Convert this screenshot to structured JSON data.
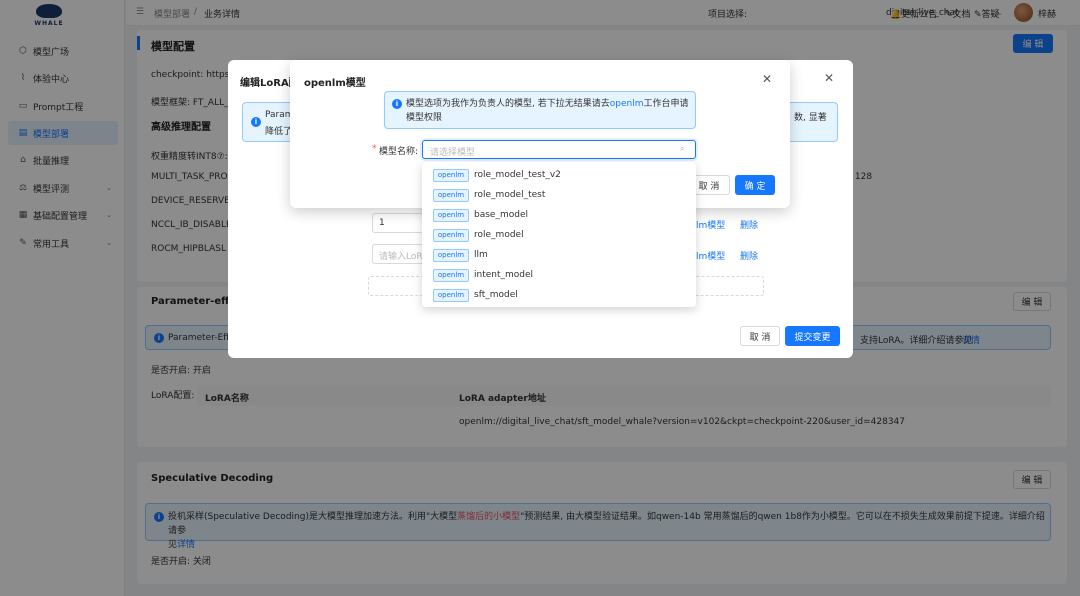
{
  "brand": {
    "logo_text": "WHALE"
  },
  "sidebar": {
    "items": [
      {
        "label": "模型广场",
        "icon": "cube-icon",
        "glyph": "⬡",
        "has_chevron": false
      },
      {
        "label": "体验中心",
        "icon": "chart-icon",
        "glyph": "⌇",
        "has_chevron": false
      },
      {
        "label": "Prompt工程",
        "icon": "chat-icon",
        "glyph": "▭",
        "has_chevron": false
      },
      {
        "label": "模型部署",
        "icon": "deploy-icon",
        "glyph": "▤",
        "has_chevron": false,
        "active": true
      },
      {
        "label": "批量推理",
        "icon": "batch-icon",
        "glyph": "⌂",
        "has_chevron": false
      },
      {
        "label": "模型评测",
        "icon": "eval-icon",
        "glyph": "⚖",
        "has_chevron": true
      },
      {
        "label": "基础配置管理",
        "icon": "grid-icon",
        "glyph": "▦",
        "has_chevron": true
      },
      {
        "label": "常用工具",
        "icon": "tool-icon",
        "glyph": "✎",
        "has_chevron": true
      }
    ]
  },
  "header": {
    "breadcrumb_parent": "模型部署",
    "breadcrumb_sep": "/",
    "breadcrumb_current": "业务详情",
    "project_label": "项目选择:",
    "project_value": "digital_live_chat",
    "announcement": "更新公告",
    "docs": "文档",
    "qa": "答疑",
    "username": "梓赫"
  },
  "page": {
    "model_config_title": "模型配置",
    "edit": "编 辑",
    "checkpoint_label": "checkpoint: https",
    "framework_label": "模型框架: FT_ALL_",
    "advanced_title": "高级推理配置",
    "int8_label": "权重精度转INT8⑦:",
    "multi_task": "MULTI_TASK_PRO",
    "multi_task_value": ": 128",
    "device_reserve": "DEVICE_RESERVE",
    "nccl": "NCCL_IB_DISABLE",
    "rocm": "ROCM_HIPBLASL",
    "peft_title": "Parameter-effic",
    "peft_alert": "Parameter-Effic",
    "peft_alert_right": "支持LoRA。详细介绍请参见",
    "detail_link": "详情",
    "enabled_label": "是否开启: 开启",
    "lora_label": "LoRA配置:",
    "lora_name_header": "LoRA名称",
    "lora_addr_header": "LoRA adapter地址",
    "lora_addr_value": "openlm://digital_live_chat/sft_model_whale?version=v102&ckpt=checkpoint-220&user_id=428347",
    "spec_title": "Speculative Decoding",
    "spec_alert_1": "投机采样(Speculative Decoding)是大模型推理加速方法。利用\"大模型",
    "spec_alert_red": "蒸馏后的小模型",
    "spec_alert_2": "\"预测结果, 由大模型验证结果。如qwen-14b 常用蒸馏后的qwen 1b8作为小模型。它可以在不损失生成效果前提下提速。详细介绍请参",
    "spec_alert_3": "见",
    "spec_enabled": "是否开启: 关闭"
  },
  "lora_modal": {
    "title": "编辑LoRA配",
    "alert_start": "Param",
    "alert_start2": "降低了",
    "alert_right": "数, 显著",
    "input_value": "1",
    "input_placeholder": "请输入LoRA",
    "openlm_model_link": "lm模型",
    "delete_link": "删除",
    "cancel": "取 消",
    "submit": "提交变更"
  },
  "model_modal": {
    "title": "openlm模型",
    "info_text_1": "模型选项为我作为负责人的模型, 若下拉无结果请去",
    "info_link": "openlm",
    "info_text_2": "工作台申请",
    "info_text_3": "模型权限",
    "required_mark": "*",
    "field_label": "模型名称:",
    "select_placeholder": "请选择模型",
    "cancel": "取 消",
    "confirm": "确 定"
  },
  "dropdown": {
    "tag": "openlm",
    "options": [
      "role_model_test_v2",
      "role_model_test",
      "base_model",
      "role_model",
      "llm",
      "intent_model",
      "sft_model"
    ]
  }
}
